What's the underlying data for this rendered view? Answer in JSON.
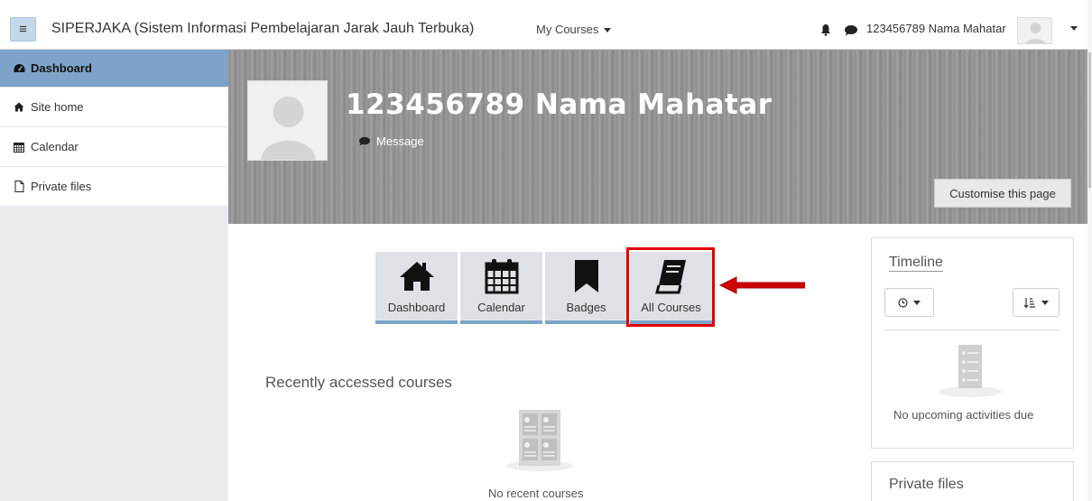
{
  "navbar": {
    "toggle_icon": "hamburger-icon",
    "brand": "SIPERJAKA (Sistem Informasi Pembelajaran Jarak Jauh Terbuka)",
    "my_courses": "My Courses",
    "username": "123456789 Nama Mahatar"
  },
  "sidebar": {
    "items": [
      {
        "label": "Dashboard",
        "icon": "dashboard-icon",
        "active": true
      },
      {
        "label": "Site home",
        "icon": "home-icon"
      },
      {
        "label": "Calendar",
        "icon": "calendar-icon"
      },
      {
        "label": "Private files",
        "icon": "file-icon"
      }
    ]
  },
  "header": {
    "name": "123456789 Nama Mahatar",
    "message": "Message",
    "customise": "Customise this page"
  },
  "tiles": [
    {
      "label": "Dashboard",
      "icon": "home-icon"
    },
    {
      "label": "Calendar",
      "icon": "calendar-icon"
    },
    {
      "label": "Badges",
      "icon": "bookmark-icon"
    },
    {
      "label": "All Courses",
      "icon": "book-icon",
      "highlighted": true
    }
  ],
  "recent": {
    "title": "Recently accessed courses",
    "empty": "No recent courses"
  },
  "timeline": {
    "title": "Timeline",
    "empty": "No upcoming activities due"
  },
  "private_files": {
    "title": "Private files"
  },
  "colors": {
    "accent": "#7da4c8",
    "highlight": "#e00000"
  }
}
